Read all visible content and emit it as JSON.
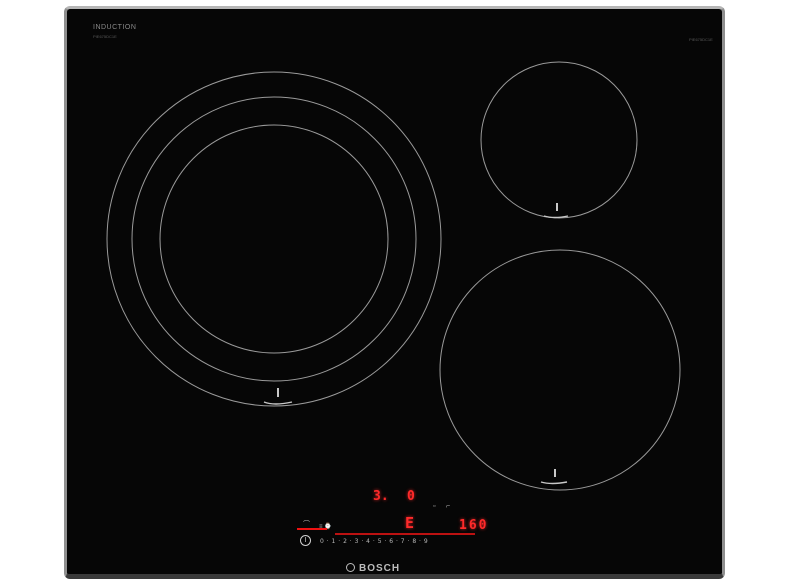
{
  "brand": {
    "line1": "INDUCTION",
    "line2": "PIE675DC1E",
    "model": "PIE675DC1E",
    "logo": "BOSCH"
  },
  "display": {
    "zone_readout": "3.",
    "zone_level": "0",
    "center_symbol": "E",
    "temperature": "160",
    "scale_labels": [
      "0",
      "•",
      "1",
      "•",
      "2",
      "•",
      "3",
      "•",
      "4",
      "•",
      "5",
      "•",
      "6",
      "•",
      "7",
      "•",
      "8",
      "•",
      "9"
    ],
    "scale_text": "0 · 1 · 2 · 3 · 4 · 5 · 6 · 7 · 8 · 9"
  },
  "colors": {
    "glass": "#060606",
    "ring": "#9a9a9a",
    "led": "#ff2a2a",
    "frame": "#8f8f8f"
  },
  "icons": [
    "cookware-marker-icon",
    "power-icon",
    "wifi-icon",
    "timer-icon",
    "lock-icon",
    "bosch-logo-icon"
  ]
}
